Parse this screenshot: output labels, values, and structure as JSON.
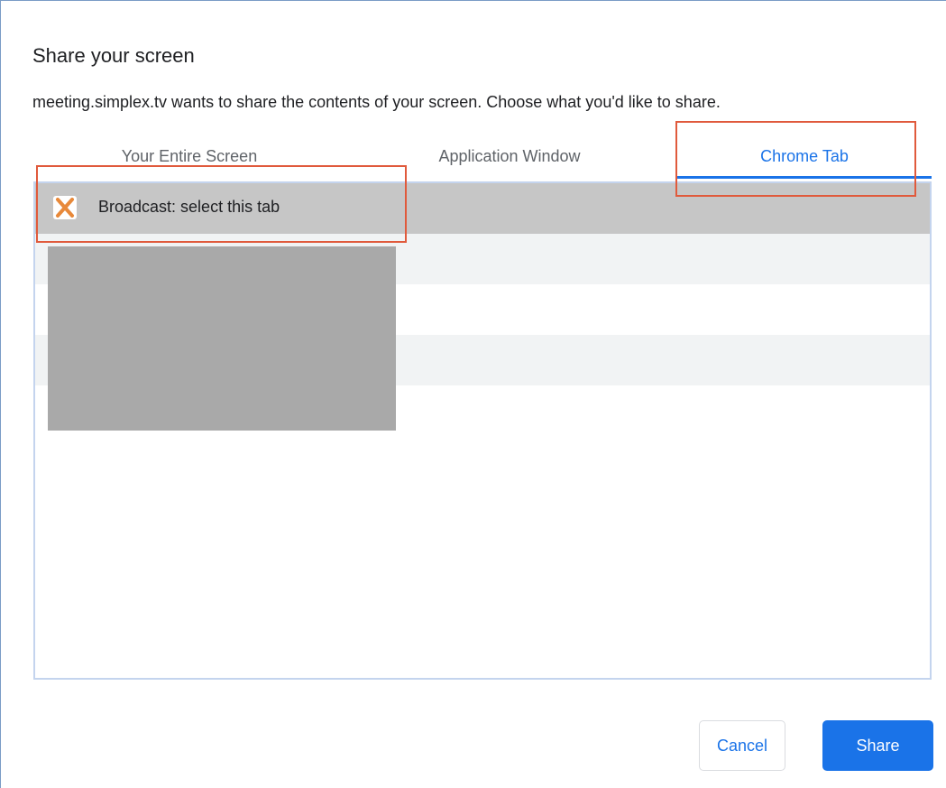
{
  "dialog": {
    "title": "Share your screen",
    "description": "meeting.simplex.tv wants to share the contents of your screen. Choose what you'd like to share."
  },
  "tabs": [
    {
      "label": "Your Entire Screen",
      "selected": false
    },
    {
      "label": "Application Window",
      "selected": false
    },
    {
      "label": "Chrome Tab",
      "selected": true
    }
  ],
  "tab_list": {
    "items": [
      {
        "label": "Broadcast: select this tab",
        "icon": "simplex-x-favicon-icon",
        "selected": true
      }
    ]
  },
  "buttons": {
    "cancel_label": "Cancel",
    "share_label": "Share"
  },
  "colors": {
    "accent": "#1a73e8",
    "annotation": "#e05a3c",
    "favicon": "#e8893a",
    "selected_row": "#c6c6c6"
  }
}
